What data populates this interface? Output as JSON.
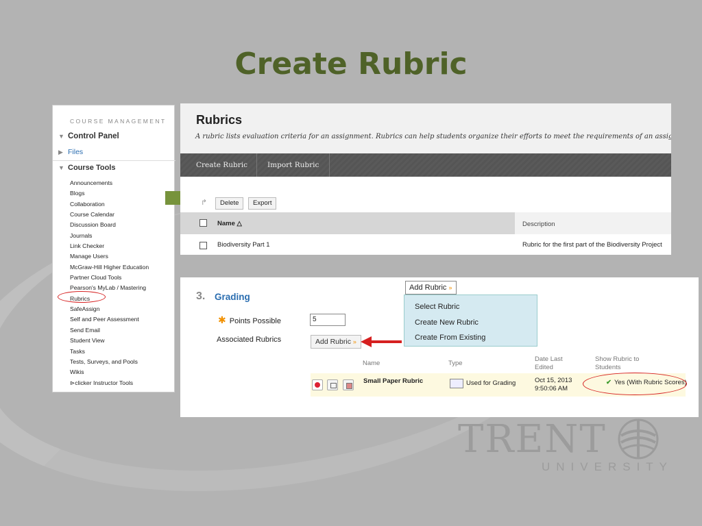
{
  "slide": {
    "title": "Create Rubric"
  },
  "sidebar": {
    "section_label": "COURSE MANAGEMENT",
    "control_panel": "Control Panel",
    "files": "Files",
    "course_tools": "Course Tools",
    "tools": [
      "Announcements",
      "Blogs",
      "Collaboration",
      "Course Calendar",
      "Discussion Board",
      "Journals",
      "Link Checker",
      "Manage Users",
      "McGraw-Hill Higher Education",
      "Partner Cloud Tools",
      "Pearson's MyLab / Mastering",
      "Rubrics",
      "SafeAssign",
      "Self and Peer Assessment",
      "Send Email",
      "Student View",
      "Tasks",
      "Tests, Surveys, and Pools",
      "Wikis",
      "⊳clicker Instructor Tools"
    ]
  },
  "rubrics": {
    "title": "Rubrics",
    "description": "A rubric lists evaluation criteria for an assignment. Rubrics can help students organize their efforts to meet the requirements of an assignment.",
    "tabs": [
      "Create Rubric",
      "Import Rubric"
    ],
    "delete_label": "Delete",
    "export_label": "Export",
    "col_name": "Name △",
    "col_description": "Description",
    "row_name": "Biodiversity Part 1",
    "row_description": "Rubric for the first part of the Biodiversity Project"
  },
  "grading": {
    "number": "3.",
    "title": "Grading",
    "points_label": "Points Possible",
    "points_value": "5",
    "associated_label": "Associated Rubrics",
    "add_rubric_label": "Add Rubric",
    "dropdown_items": [
      "Select Rubric",
      "Create New Rubric",
      "Create From Existing"
    ],
    "headers": {
      "name": "Name",
      "type": "Type",
      "date_line1": "Date Last",
      "date_line2": "Edited",
      "show_line1": "Show Rubric to",
      "show_line2": "Students"
    },
    "row": {
      "name": "Small Paper Rubric",
      "type": "Used for Grading",
      "date_line1": "Oct 15, 2013",
      "date_line2": "9:50:06 AM",
      "show": "Yes (With Rubric Scores)"
    }
  },
  "logo": {
    "word": "TRENT",
    "sub": "UNIVERSITY"
  },
  "colors": {
    "title_green": "#4f6228",
    "link_blue": "#2a6db0",
    "highlight_red": "#d62020",
    "arrow_green": "#77933c"
  }
}
